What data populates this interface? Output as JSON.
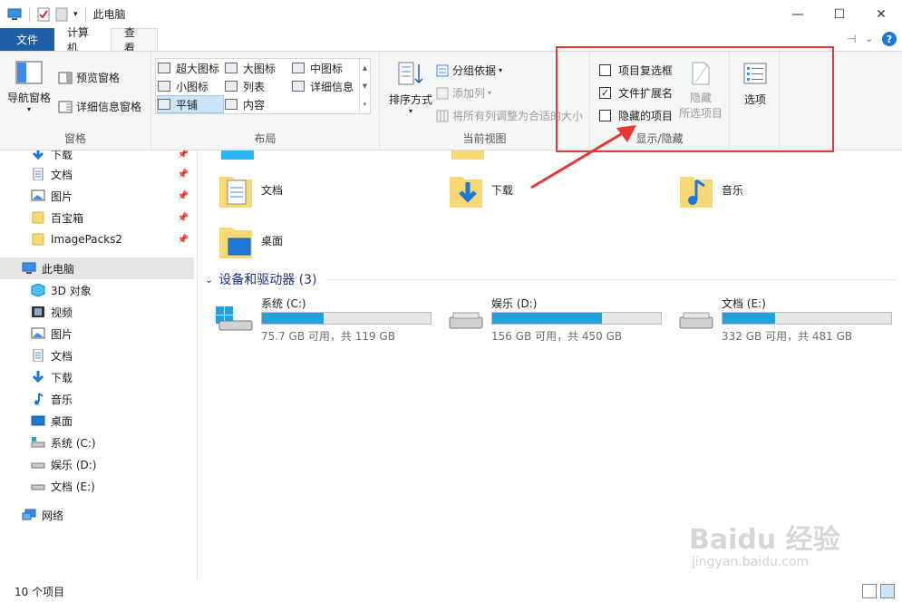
{
  "window": {
    "title": "此电脑"
  },
  "tabs": {
    "file": "文件",
    "computer": "计算机",
    "view": "查看"
  },
  "ribbon": {
    "pane": {
      "label": "窗格",
      "nav_pane": "导航窗格",
      "preview_pane": "预览窗格",
      "details_pane": "详细信息窗格"
    },
    "layout": {
      "label": "布局",
      "extra_large": "超大图标",
      "large": "大图标",
      "medium": "中图标",
      "small": "小图标",
      "list": "列表",
      "details": "详细信息",
      "tiles": "平铺",
      "content": "内容"
    },
    "current_view": {
      "label": "当前视图",
      "sort_by": "排序方式",
      "group_by": "分组依据",
      "add_columns": "添加列",
      "size_all_columns": "将所有列调整为合适的大小"
    },
    "show_hide": {
      "label": "显示/隐藏",
      "item_checkboxes": "项目复选框",
      "item_checkboxes_checked": false,
      "file_extensions": "文件扩展名",
      "file_extensions_checked": true,
      "hidden_items": "隐藏的项目",
      "hidden_items_checked": false,
      "hide_selected_1": "隐藏",
      "hide_selected_2": "所选项目"
    },
    "options": "选项"
  },
  "nav": {
    "quick": [
      "下载",
      "文档",
      "图片",
      "百宝箱",
      "ImagePacks2"
    ],
    "this_pc": "此电脑",
    "pc_items": [
      "3D 对象",
      "视频",
      "图片",
      "文档",
      "下载",
      "音乐",
      "桌面",
      "系统 (C:)",
      "娱乐 (D:)",
      "文档 (E:)"
    ],
    "network": "网络"
  },
  "main": {
    "folders": [
      "文档",
      "下载",
      "音乐",
      "桌面"
    ],
    "section_title": "设备和驱动器 (3)",
    "drives": [
      {
        "name": "系统 (C:)",
        "info": "75.7 GB 可用，共 119 GB",
        "used_fraction": 0.364
      },
      {
        "name": "娱乐 (D:)",
        "info": "156 GB 可用，共 450 GB",
        "used_fraction": 0.653
      },
      {
        "name": "文档 (E:)",
        "info": "332 GB 可用，共 481 GB",
        "used_fraction": 0.31
      }
    ]
  },
  "status": {
    "count": "10 个项目"
  },
  "watermark": {
    "brand": "Baidu 经验",
    "url": "jingyan.baidu.com"
  },
  "colors": {
    "accent": "#1e5fa8",
    "drive_bar": "#26a0da",
    "highlight_box": "#e53935",
    "arrow": "#e53935"
  }
}
